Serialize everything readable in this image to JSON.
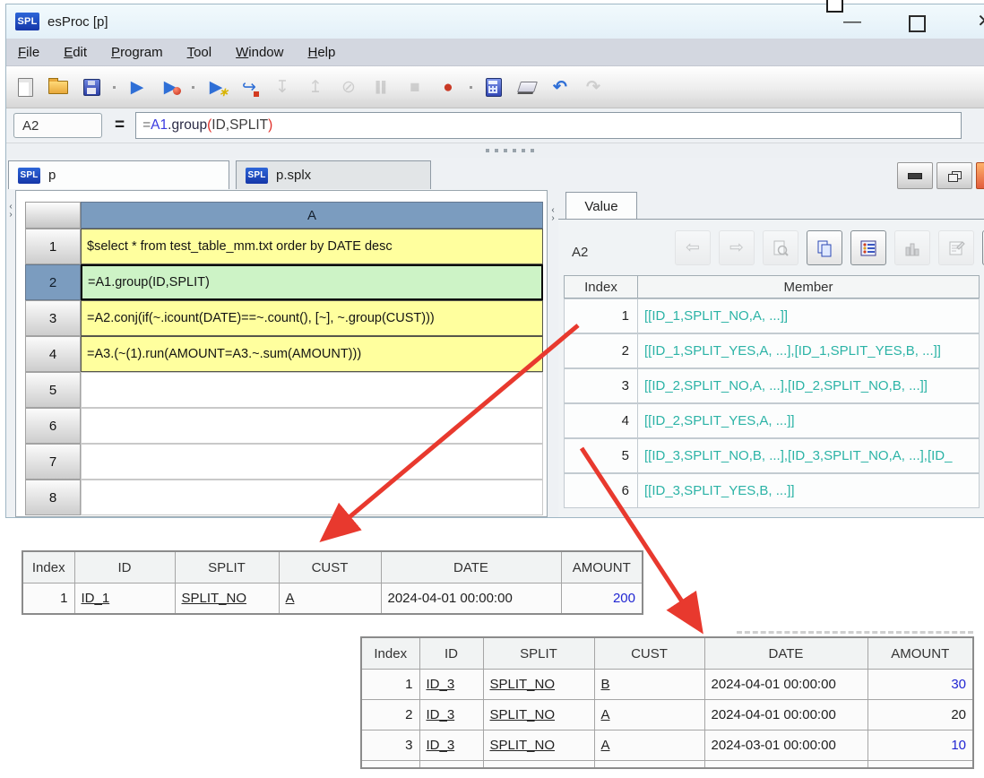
{
  "window": {
    "logo": "SPL",
    "title": "esProc  [p]",
    "controls": {
      "minimize": "—",
      "close": "✕"
    }
  },
  "menu": {
    "items": [
      "File",
      "Edit",
      "Program",
      "Tool",
      "Window",
      "Help"
    ]
  },
  "toolbar": {
    "icons": [
      {
        "name": "new-file-icon",
        "enabled": true
      },
      {
        "name": "open-file-icon",
        "enabled": true
      },
      {
        "name": "save-icon",
        "enabled": true
      },
      {
        "name": "run-icon",
        "glyph": "▶",
        "enabled": true
      },
      {
        "name": "debug-run-icon",
        "glyph": "▶",
        "enabled": true
      },
      {
        "name": "run-to-cursor-icon",
        "glyph": "▶",
        "enabled": true
      },
      {
        "name": "step-over-icon",
        "glyph": "↪",
        "enabled": true
      },
      {
        "name": "step-into-icon",
        "glyph": "↧",
        "enabled": false
      },
      {
        "name": "step-return-icon",
        "glyph": "↥",
        "enabled": false
      },
      {
        "name": "interrupt-icon",
        "glyph": "⊘",
        "enabled": false
      },
      {
        "name": "pause-icon",
        "glyph": "▌▌",
        "enabled": false
      },
      {
        "name": "stop-icon",
        "glyph": "■",
        "enabled": false
      },
      {
        "name": "breakpoint-icon",
        "glyph": "●",
        "enabled": true
      },
      {
        "name": "calculator-icon",
        "enabled": true
      },
      {
        "name": "eraser-icon",
        "enabled": true
      },
      {
        "name": "undo-icon",
        "glyph": "↶",
        "enabled": true
      },
      {
        "name": "redo-icon",
        "glyph": "↷",
        "enabled": false
      }
    ]
  },
  "formula_bar": {
    "cell_ref": "A2",
    "equals": "=",
    "parts": [
      "=",
      "A1",
      ".group",
      "(",
      "ID,SPLIT",
      ")"
    ]
  },
  "tabs": [
    {
      "logo": "SPL",
      "label": "p",
      "active": true
    },
    {
      "logo": "SPL",
      "label": "p.splx",
      "active": false
    }
  ],
  "grid": {
    "column_header": "A",
    "rows": [
      {
        "n": "1",
        "code": "$select * from test_table_mm.txt order by DATE desc",
        "bg": "yellow"
      },
      {
        "n": "2",
        "code": "=A1.group(ID,SPLIT)",
        "bg": "green",
        "selected": true
      },
      {
        "n": "3",
        "code": "=A2.conj(if(~.icount(DATE)==~.count(), [~], ~.group(CUST)))",
        "bg": "yellow"
      },
      {
        "n": "4",
        "code": "=A3.(~(1).run(AMOUNT=A3.~.sum(AMOUNT)))",
        "bg": "yellow"
      },
      {
        "n": "5",
        "code": ""
      },
      {
        "n": "6",
        "code": ""
      },
      {
        "n": "7",
        "code": ""
      },
      {
        "n": "8",
        "code": ""
      }
    ]
  },
  "value_panel": {
    "tab": "Value",
    "cell": "A2",
    "buttons": [
      {
        "name": "back-icon",
        "glyph": "⇦",
        "enabled": false
      },
      {
        "name": "forward-icon",
        "glyph": "⇨",
        "enabled": false
      },
      {
        "name": "preview-icon",
        "enabled": false
      },
      {
        "name": "copy-icon",
        "enabled": true
      },
      {
        "name": "detail-view-icon",
        "enabled": true
      },
      {
        "name": "chart-icon",
        "enabled": false
      },
      {
        "name": "properties-icon",
        "enabled": false
      },
      {
        "name": "tools-icon",
        "enabled": true
      }
    ],
    "columns": [
      "Index",
      "Member"
    ],
    "rows": [
      {
        "index": "1",
        "member": "[[ID_1,SPLIT_NO,A, ...]]"
      },
      {
        "index": "2",
        "member": "[[ID_1,SPLIT_YES,A, ...],[ID_1,SPLIT_YES,B, ...]]"
      },
      {
        "index": "3",
        "member": "[[ID_2,SPLIT_NO,A, ...],[ID_2,SPLIT_NO,B, ...]]"
      },
      {
        "index": "4",
        "member": "[[ID_2,SPLIT_YES,A, ...]]"
      },
      {
        "index": "5",
        "member": "[[ID_3,SPLIT_NO,B, ...],[ID_3,SPLIT_NO,A, ...],[ID_"
      },
      {
        "index": "6",
        "member": "[[ID_3,SPLIT_YES,B, ...]]"
      }
    ]
  },
  "table1": {
    "headers": [
      "Index",
      "ID",
      "SPLIT",
      "CUST",
      "DATE",
      "AMOUNT"
    ],
    "rows": [
      {
        "index": "1",
        "id": "ID_1",
        "split": "SPLIT_NO",
        "cust": "A",
        "date": "2024-04-01 00:00:00",
        "amount": "200"
      }
    ]
  },
  "table2": {
    "headers": [
      "Index",
      "ID",
      "SPLIT",
      "CUST",
      "DATE",
      "AMOUNT"
    ],
    "rows": [
      {
        "index": "1",
        "id": "ID_3",
        "split": "SPLIT_NO",
        "cust": "B",
        "date": "2024-04-01 00:00:00",
        "amount": "30"
      },
      {
        "index": "2",
        "id": "ID_3",
        "split": "SPLIT_NO",
        "cust": "A",
        "date": "2024-04-01 00:00:00",
        "amount": "20"
      },
      {
        "index": "3",
        "id": "ID_3",
        "split": "SPLIT_NO",
        "cust": "A",
        "date": "2024-03-01 00:00:00",
        "amount": "10"
      }
    ]
  },
  "colors": {
    "annotation_red": "#e8392e",
    "member_teal": "#2bb3a6",
    "amount_blue": "#2126d2",
    "header_blue": "#7b9cbf",
    "cell_yellow": "#ffff9e",
    "cell_green": "#cdf3c6"
  }
}
